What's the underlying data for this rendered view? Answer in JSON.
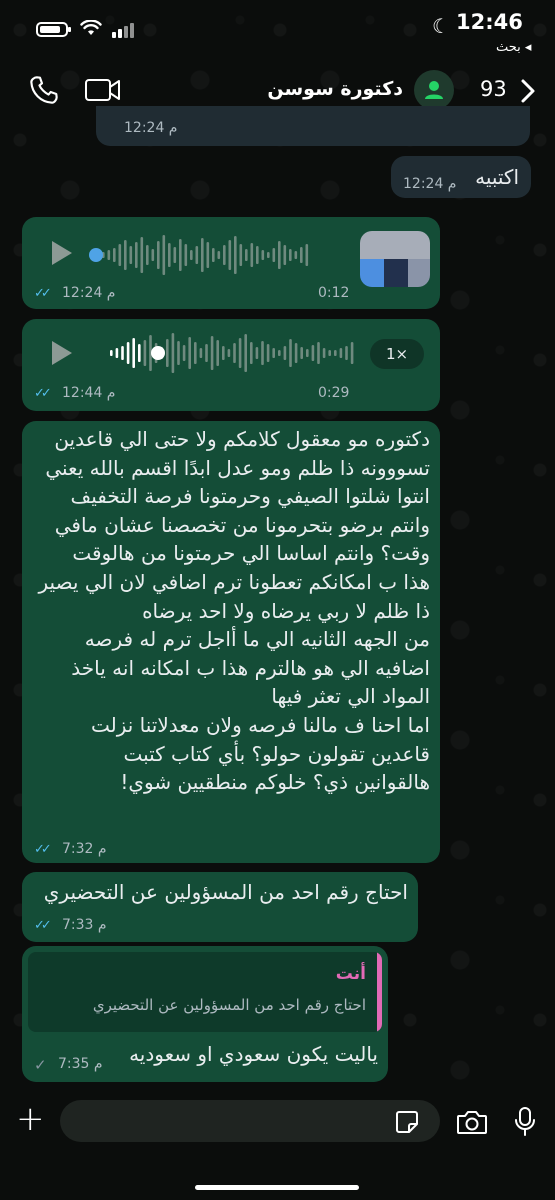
{
  "status_bar": {
    "time": "12:46",
    "back_label": "بحث ◂"
  },
  "header": {
    "contact_name": "دكتورة سوسن",
    "unread_count": "93"
  },
  "messages": [
    {
      "id": "m0",
      "time": "12:24 م"
    },
    {
      "id": "m1",
      "text": "اكتبيه",
      "time": "12:24 م"
    },
    {
      "id": "m2",
      "type": "voice",
      "duration": "0:12",
      "time": "12:24 م"
    },
    {
      "id": "m3",
      "type": "voice",
      "duration": "0:29",
      "time": "12:44 م",
      "speed": "1×"
    },
    {
      "id": "m4",
      "lines": [
        "دكتوره مو معقول كلامكم ولا حتى الي قاعدين",
        "تسووونه ذا ظلم ومو عدل ابدًا اقسم بالله يعني",
        "انتوا شلتوا الصيفي وحرمتونا فرصة التخفيف",
        "وانتم برضو بتحرمونا من تخصصنا عشان مافي",
        "وقت؟ وانتم اساسا الي حرمتونا من هالوقت",
        "هذا ب امكانكم تعطونا ترم اضافي لان الي يصير",
        "ذا ظلم لا ربي يرضاه ولا احد يرضاه",
        "من الجهه الثانيه الي ما أاجل ترم له فرصه",
        "اضافيه الي هو هالترم هذا ب امكانه انه ياخذ",
        "المواد الي تعثر فيها",
        "اما احنا ف مالنا فرصه ولان معدلاتنا نزلت",
        "قاعدين تقولون حولو؟ بأي كتاب كتبت",
        "هالقوانين ذي؟ خلوكم منطقيين شوي!"
      ],
      "time": "7:32 م"
    },
    {
      "id": "m5",
      "text": "احتاج رقم احد من المسؤولين عن التحضيري",
      "time": "7:33 م"
    },
    {
      "id": "m6",
      "reply_author": "أنت",
      "reply_text": "احتاج رقم احد من المسؤولين عن التحضيري",
      "text": "ياليت يكون سعودي او سعوديه",
      "time": "7:35 م"
    }
  ],
  "colors": {
    "outgoing": "#144d37",
    "incoming": "#202c33",
    "read_ticks": "#53bdeb",
    "reply_accent": "#e26ab6"
  },
  "icons": [
    "phone-icon",
    "video-icon",
    "avatar-icon",
    "chevron-right-icon",
    "play-icon",
    "plus-icon",
    "sticker-icon",
    "camera-icon",
    "mic-icon"
  ]
}
